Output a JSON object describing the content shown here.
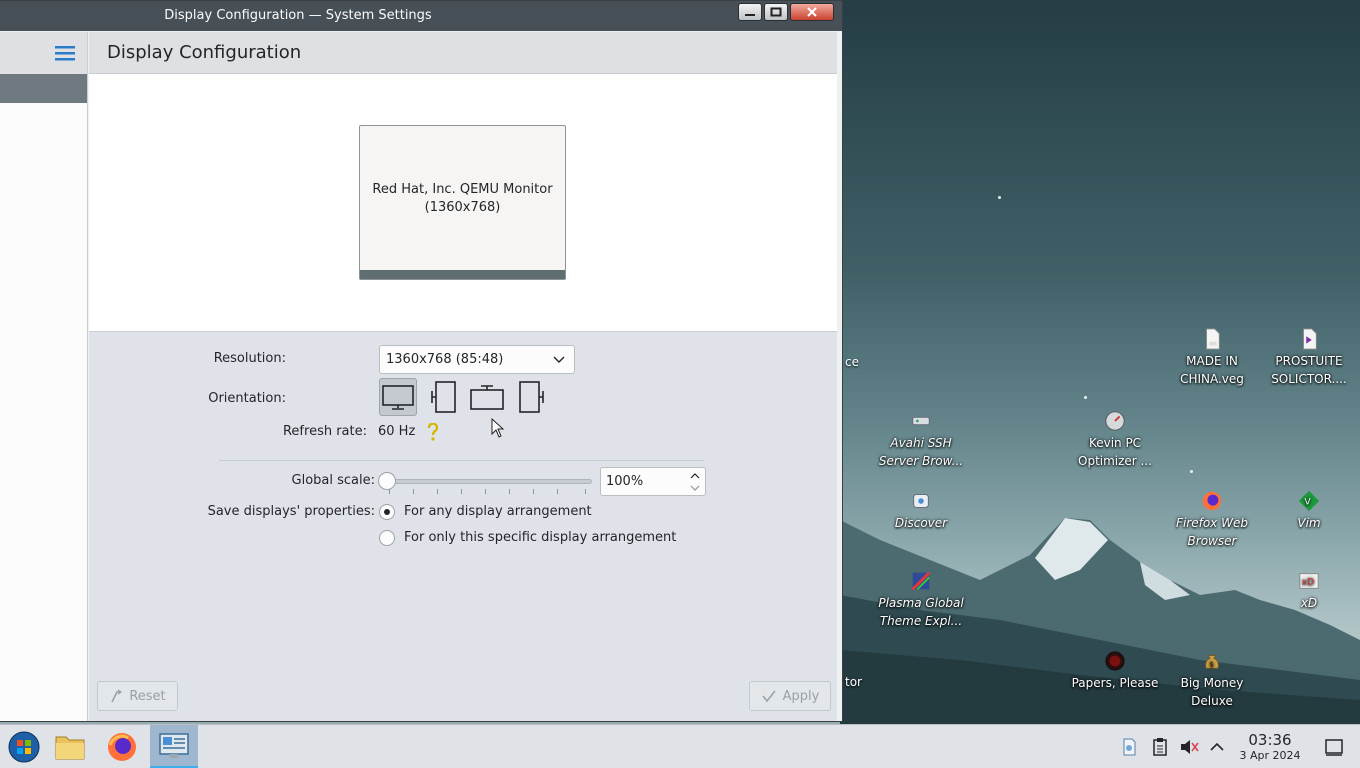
{
  "window": {
    "title": "Display Configuration — System Settings",
    "header_title": "Display Configuration"
  },
  "monitor": {
    "name": "Red Hat, Inc. QEMU Monitor",
    "resolution_label": "(1360x768)"
  },
  "form": {
    "resolution_label": "Resolution:",
    "resolution_value": "1360x768 (85:48)",
    "orientation_label": "Orientation:",
    "refresh_label": "Refresh rate:",
    "refresh_value": "60 Hz",
    "scale_label": "Global scale:",
    "scale_value": "100%",
    "scale_level_percent": 0,
    "save_label": "Save displays' properties:",
    "save_options": [
      "For any display arrangement",
      "For only this specific display arrangement"
    ],
    "save_selected_index": 0
  },
  "buttons": {
    "reset": "Reset",
    "apply": "Apply"
  },
  "desktop": {
    "icons": [
      {
        "label": "MADE IN CHINA.veg",
        "icon": "file-icon"
      },
      {
        "label": "PROSTUITE SOLICTOR....",
        "icon": "visual-studio-file-icon"
      },
      {
        "label": "Avahi SSH Server Brow...",
        "icon": "network-icon"
      },
      {
        "label": "Kevin PC Optimizer ...",
        "icon": "optimizer-icon"
      },
      {
        "label": "Discover",
        "icon": "discover-icon"
      },
      {
        "label": "Firefox Web Browser",
        "icon": "firefox-icon"
      },
      {
        "label": "Vim",
        "icon": "vim-icon"
      },
      {
        "label": "Plasma Global Theme Expl...",
        "icon": "theme-explorer-icon"
      },
      {
        "label": "xD",
        "icon": "xd-icon"
      },
      {
        "label": "Papers, Please",
        "icon": "papers-please-icon"
      },
      {
        "label": "Big Money Deluxe",
        "icon": "money-bag-icon"
      }
    ],
    "clipped_text_1": "ce",
    "clipped_text_2": "tor"
  },
  "taskbar": {
    "time": "03:36",
    "date": "3 Apr 2024"
  },
  "colors": {
    "titlebar": "#475057",
    "selection": "#6f7a80",
    "accent": "#3daee9"
  }
}
